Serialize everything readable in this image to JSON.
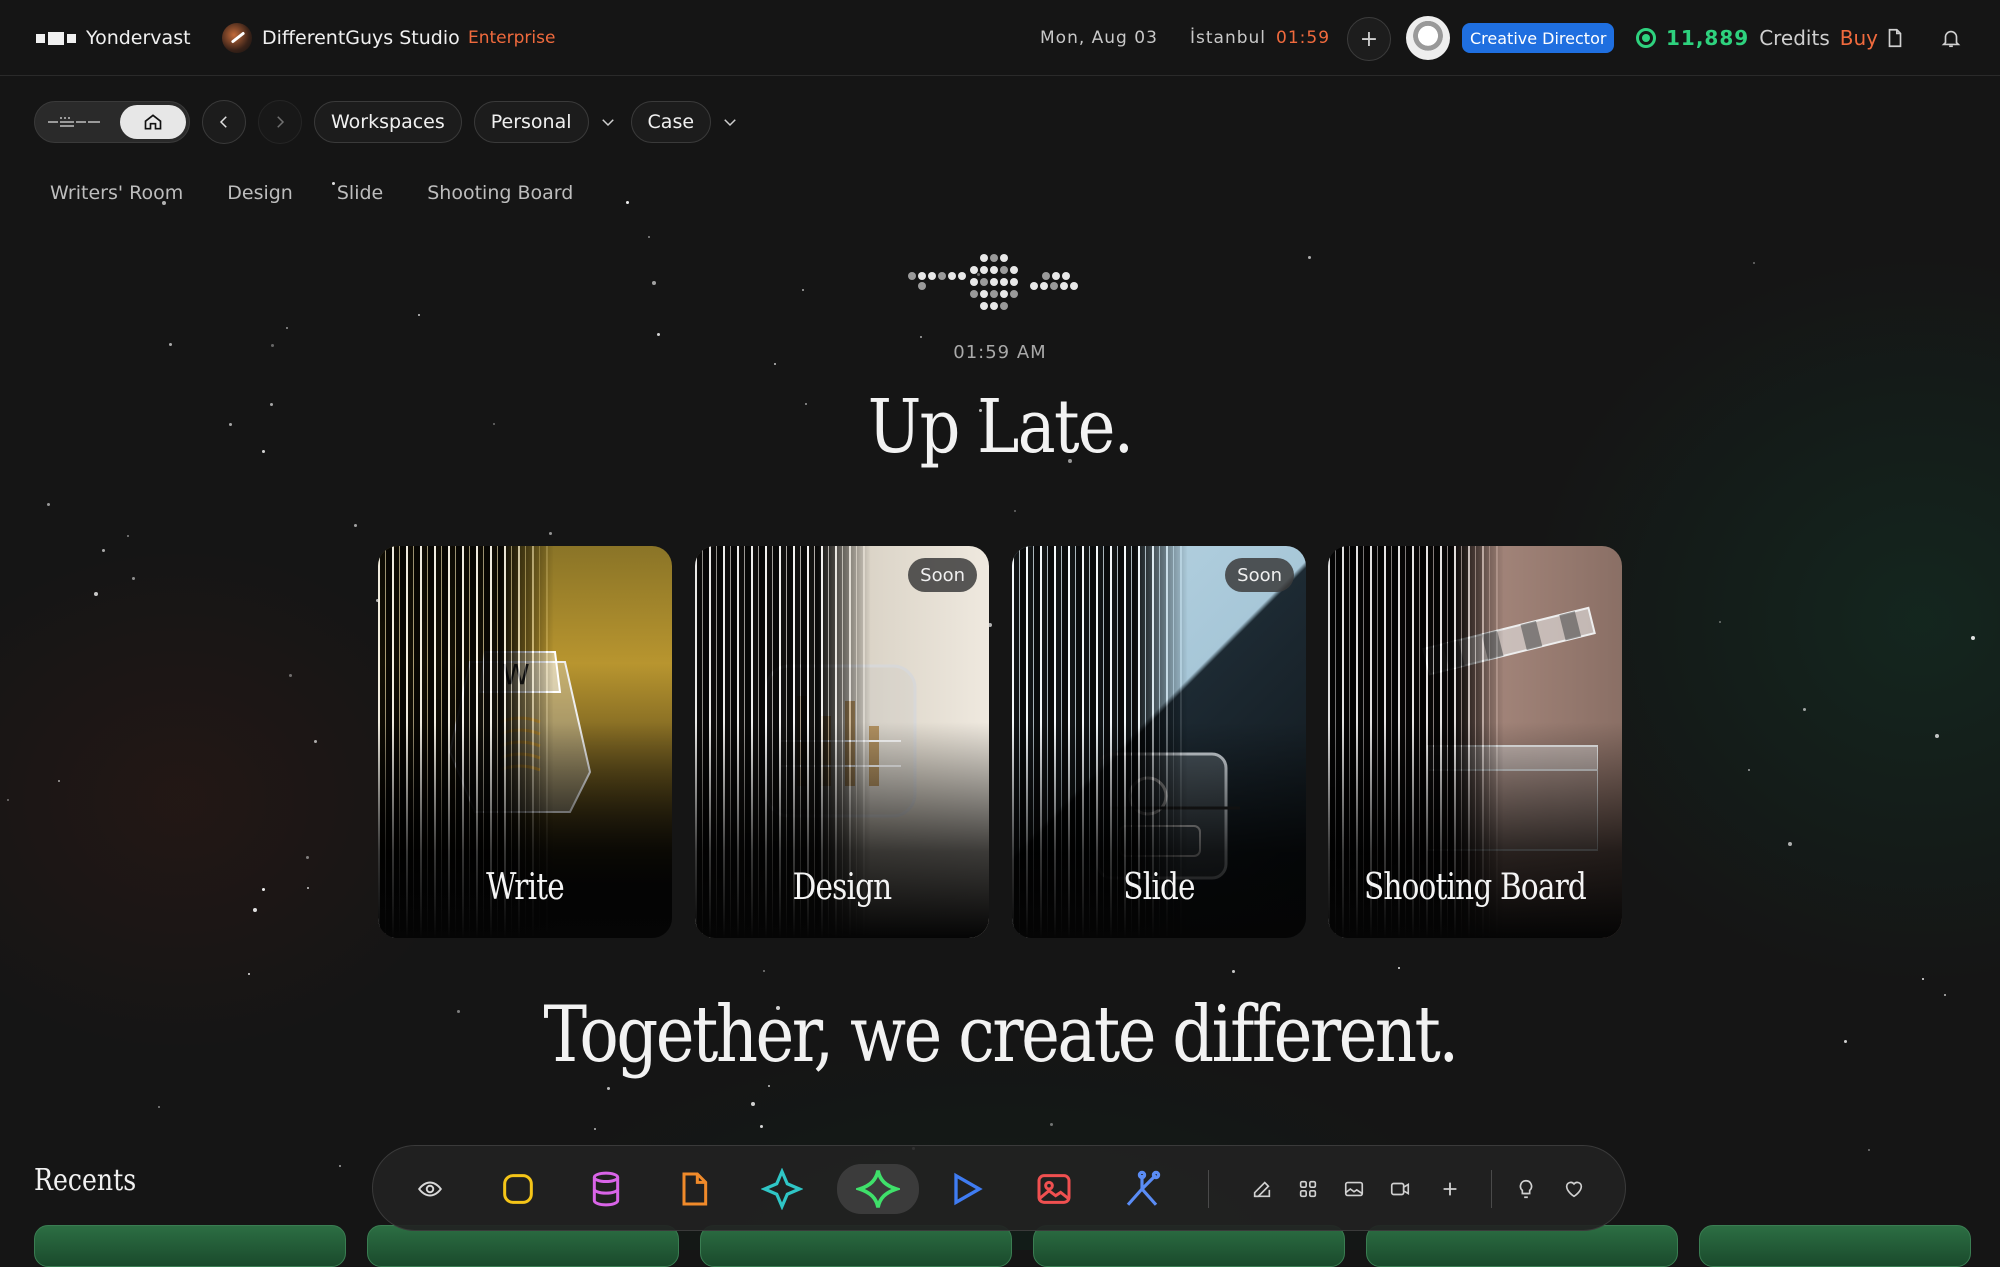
{
  "topbar": {
    "brand": "Yondervast",
    "studio": "DifferentGuys Studio",
    "plan": "Enterprise",
    "date": "Mon, Aug 03",
    "city": "İstanbul",
    "city_time": "01:59",
    "role": "Creative Director",
    "credits_value": "11,889",
    "credits_label": "Credits",
    "buy_label": "Buy"
  },
  "nav": {
    "workspaces": "Workspaces",
    "personal": "Personal",
    "case": "Case"
  },
  "subnav": [
    "Writers' Room",
    "Design",
    "Slide",
    "Shooting Board"
  ],
  "hero": {
    "time": "01:59 AM",
    "greeting": "Up Late.",
    "tagline": "Together, we create different."
  },
  "cards": [
    {
      "title": "Write",
      "badge": ""
    },
    {
      "title": "Design",
      "badge": "Soon"
    },
    {
      "title": "Slide",
      "badge": "Soon"
    },
    {
      "title": "Shooting Board",
      "badge": ""
    }
  ],
  "recents": {
    "title": "Recents"
  },
  "dock": {
    "items": [
      "eye-icon",
      "square-icon",
      "database-icon",
      "file-icon",
      "diamond-star-icon",
      "sparkle-icon",
      "play-icon",
      "image-icon",
      "branch-icon"
    ],
    "tools": [
      "edit-icon",
      "grid-icon",
      "image-small-icon",
      "video-icon",
      "plus-icon",
      "bulb-icon",
      "heart-icon"
    ]
  },
  "colors": {
    "accent_orange": "#f06a3d",
    "credits_green": "#2ed27e",
    "role_blue": "#1f6fe0",
    "background": "#151515"
  }
}
